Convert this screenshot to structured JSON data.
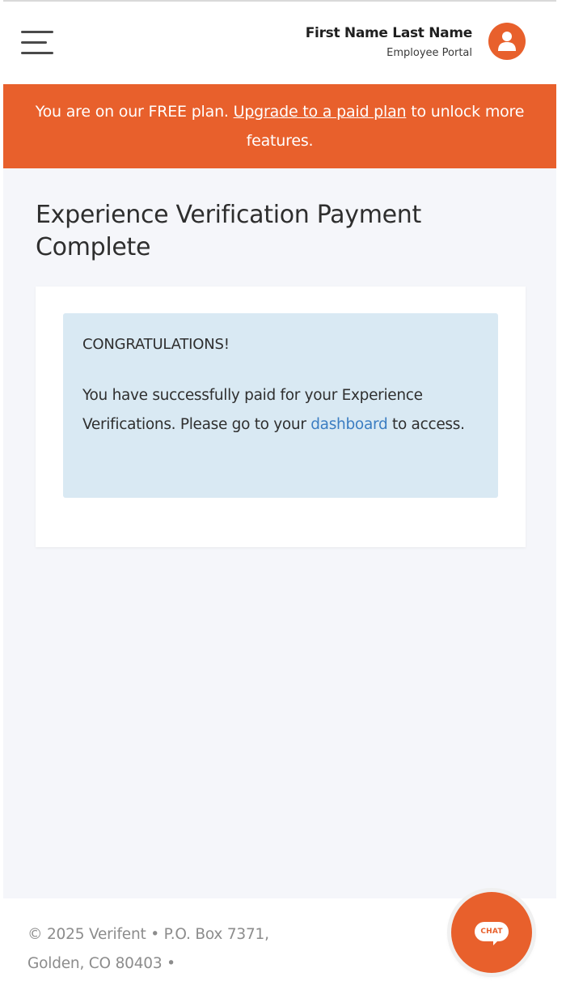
{
  "header": {
    "menu_icon": "hamburger-menu-icon",
    "user_name": "First Name Last Name",
    "portal_label": "Employee Portal",
    "avatar_icon": "user-avatar-icon"
  },
  "banner": {
    "text_before": "You are on our FREE plan. ",
    "link_text": "Upgrade to a paid plan",
    "text_after": " to unlock more features."
  },
  "page": {
    "title": "Experience Verification Payment Complete"
  },
  "alert": {
    "heading": "CONGRATULATIONS!",
    "body_before": "You have successfully paid for your Experience Verifications. Please go to your ",
    "link_text": "dashboard",
    "body_after": " to access."
  },
  "footer": {
    "text": "© 2025 Verifent • P.O. Box 7371, Golden, CO 80403 •"
  },
  "chat": {
    "label": "CHAT",
    "icon": "chat-bubble-icon"
  },
  "colors": {
    "accent": "#e8602c",
    "alert_background": "#d9e9f3",
    "link": "#3b7dc2",
    "page_background": "#f5f6fa"
  }
}
